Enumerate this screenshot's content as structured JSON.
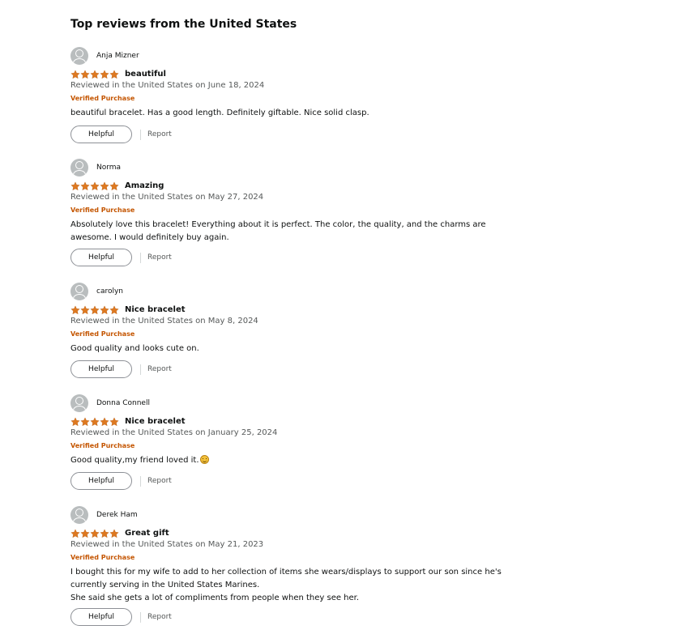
{
  "header": {
    "title": "Top reviews from the United States"
  },
  "colors": {
    "star": "#de7921",
    "verified": "#c45500",
    "text": "#0f1111",
    "muted": "#565959"
  },
  "icons": {
    "avatar": "default-profile-avatar-icon",
    "star": "star-icon",
    "emoji": "smiling-face-emoji-icon"
  },
  "reviews": [
    {
      "author": "Anja Mizner",
      "rating": 5,
      "rating_max": 5,
      "title": "beautiful",
      "date": "Reviewed in the United States on June 18, 2024",
      "badge": "Verified Purchase",
      "body": [
        "beautiful bracelet. Has a good length. Definitely giftable. Nice solid clasp."
      ],
      "helpful_label": "Helpful",
      "report_label": "Report"
    },
    {
      "author": "Norma",
      "rating": 5,
      "rating_max": 5,
      "title": "Amazing",
      "date": "Reviewed in the United States on May 27, 2024",
      "badge": "Verified Purchase",
      "body": [
        "Absolutely love this bracelet! Everything about it is perfect. The color, the quality, and the charms are",
        "awesome. I would definitely buy again."
      ],
      "helpful_label": "Helpful",
      "report_label": "Report"
    },
    {
      "author": "carolyn",
      "rating": 5,
      "rating_max": 5,
      "title": "Nice bracelet",
      "date": "Reviewed in the United States on May 8, 2024",
      "badge": "Verified Purchase",
      "body": [
        "Good quality and looks cute on."
      ],
      "helpful_label": "Helpful",
      "report_label": "Report"
    },
    {
      "author": "Donna Connell",
      "rating": 5,
      "rating_max": 5,
      "title": "Nice bracelet",
      "date": "Reviewed in the United States on January 25, 2024",
      "badge": "Verified Purchase",
      "body": [
        "Good quality,my friend loved it."
      ],
      "body_emoji": true,
      "helpful_label": "Helpful",
      "report_label": "Report"
    },
    {
      "author": "Derek Ham",
      "rating": 5,
      "rating_max": 5,
      "title": "Great gift",
      "date": "Reviewed in the United States on May 21, 2023",
      "badge": "Verified Purchase",
      "body": [
        "I bought this for my wife to add to her collection of items she wears/displays to support our son since he's",
        "currently serving in the United States Marines.",
        "She said she gets a lot of compliments from people when they see her."
      ],
      "helpful_label": "Helpful",
      "report_label": "Report"
    }
  ]
}
